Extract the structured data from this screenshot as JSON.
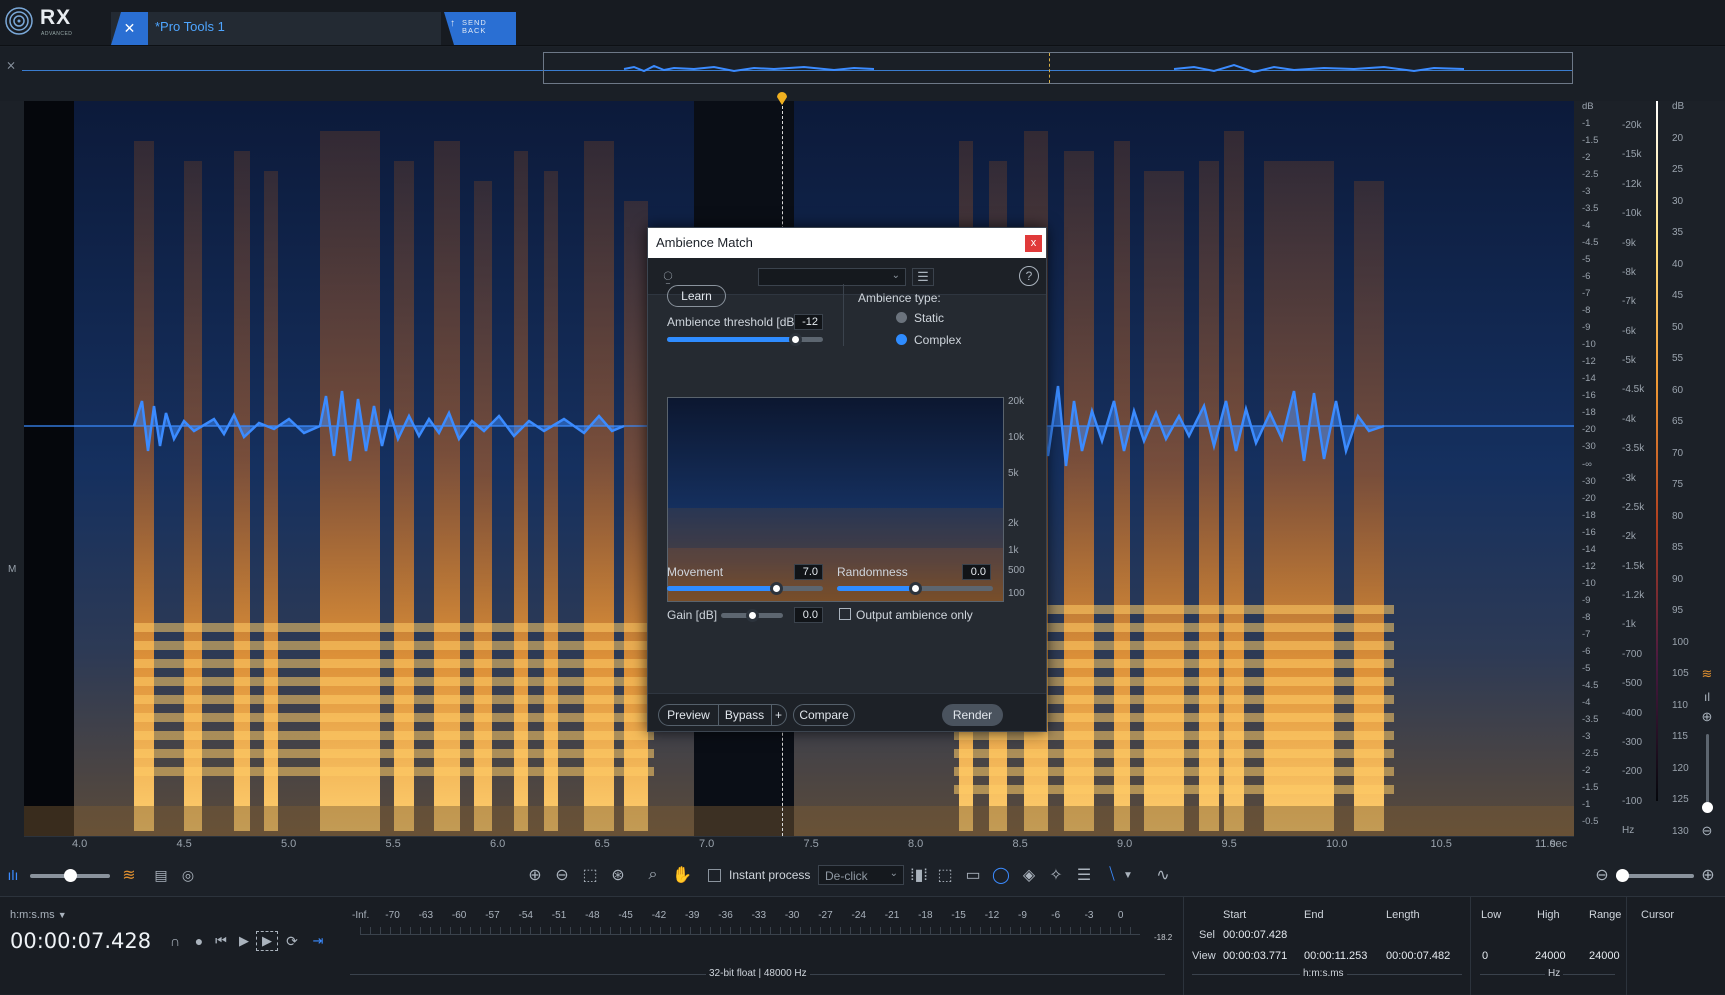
{
  "app": {
    "logo_text": "RX",
    "logo_sub": "ADVANCED",
    "tab_label": "*Pro Tools 1",
    "send_back_label": "SEND\nBACK"
  },
  "colors": {
    "accent": "#2f8cff",
    "waveform": "#3b8bff",
    "spectro_hot": "#ffb347",
    "spectro_cold": "#16305e"
  },
  "track": {
    "channel_label": "M"
  },
  "dialog": {
    "title": "Ambience Match",
    "close_label": "x",
    "learn_label": "Learn",
    "threshold_label": "Ambience threshold [dB]",
    "threshold_value": "-12",
    "threshold_fraction": 0.82,
    "ambience_type_label": "Ambience type:",
    "type_options": [
      "Static",
      "Complex"
    ],
    "type_selected": "Complex",
    "freq_labels": [
      "20k",
      "10k",
      "5k",
      "2k",
      "1k",
      "500",
      "100"
    ],
    "movement_label": "Movement",
    "movement_value": "7.0",
    "movement_fraction": 0.7,
    "randomness_label": "Randomness",
    "randomness_value": "0.0",
    "randomness_fraction": 0.5,
    "gain_label": "Gain [dB]",
    "gain_value": "0.0",
    "gain_fraction": 0.5,
    "output_only_label": "Output ambience only",
    "preview_label": "Preview",
    "bypass_label": "Bypass",
    "plus_label": "+",
    "compare_label": "Compare",
    "render_label": "Render"
  },
  "db_scale_left": [
    "dB",
    "-1",
    "-1.5",
    "-2",
    "-2.5",
    "-3",
    "-3.5",
    "-4",
    "-4.5",
    "-5",
    "-6",
    "-7",
    "-8",
    "-9",
    "-10",
    "-12",
    "-14",
    "-16",
    "-18",
    "-20",
    "-30",
    "-∞",
    "-30",
    "-20",
    "-18",
    "-16",
    "-14",
    "-12",
    "-10",
    "-9",
    "-8",
    "-7",
    "-6",
    "-5",
    "-4.5",
    "-4",
    "-3.5",
    "-3",
    "-2.5",
    "-2",
    "-1.5",
    "-1",
    "-0.5"
  ],
  "freq_scale": [
    "-20k",
    "-15k",
    "-12k",
    "-10k",
    "-9k",
    "-8k",
    "-7k",
    "-6k",
    "-5k",
    "-4.5k",
    "-4k",
    "-3.5k",
    "-3k",
    "-2.5k",
    "-2k",
    "-1.5k",
    "-1.2k",
    "-1k",
    "-700",
    "-500",
    "-400",
    "-300",
    "-200",
    "-100",
    "Hz"
  ],
  "db_scale_right": [
    "dB",
    "20",
    "25",
    "30",
    "35",
    "40",
    "45",
    "50",
    "55",
    "60",
    "65",
    "70",
    "75",
    "80",
    "85",
    "90",
    "95",
    "100",
    "105",
    "110",
    "115",
    "120",
    "125",
    "130"
  ],
  "time_axis": [
    "4.0",
    "4.5",
    "5.0",
    "5.5",
    "6.0",
    "6.5",
    "7.0",
    "7.5",
    "8.0",
    "8.5",
    "9.0",
    "9.5",
    "10.0",
    "10.5",
    "11.0",
    "sec"
  ],
  "toolbar": {
    "instant_process_label": "Instant process",
    "instant_process_tool": "De-click"
  },
  "transport": {
    "time_format": "h:m:s.ms",
    "time": "00:00:07.428"
  },
  "meter": {
    "labels": [
      "-Inf.",
      "-70",
      "-63",
      "-60",
      "-57",
      "-54",
      "-51",
      "-48",
      "-45",
      "-42",
      "-39",
      "-36",
      "-33",
      "-30",
      "-27",
      "-24",
      "-21",
      "-18",
      "-15",
      "-12",
      "-9",
      "-6",
      "-3",
      "0"
    ],
    "peak": "-18.2",
    "format": "32-bit float | 48000 Hz"
  },
  "selection": {
    "headers": [
      "Start",
      "End",
      "Length"
    ],
    "sel_label": "Sel",
    "sel_start": "00:00:07.428",
    "view_label": "View",
    "view_start": "00:00:03.771",
    "view_end": "00:00:11.253",
    "view_length": "00:00:07.482",
    "unit": "h:m:s.ms"
  },
  "freq_info": {
    "headers": [
      "Low",
      "High",
      "Range"
    ],
    "low": "0",
    "high": "24000",
    "range": "24000",
    "unit": "Hz"
  },
  "cursor_label": "Cursor"
}
